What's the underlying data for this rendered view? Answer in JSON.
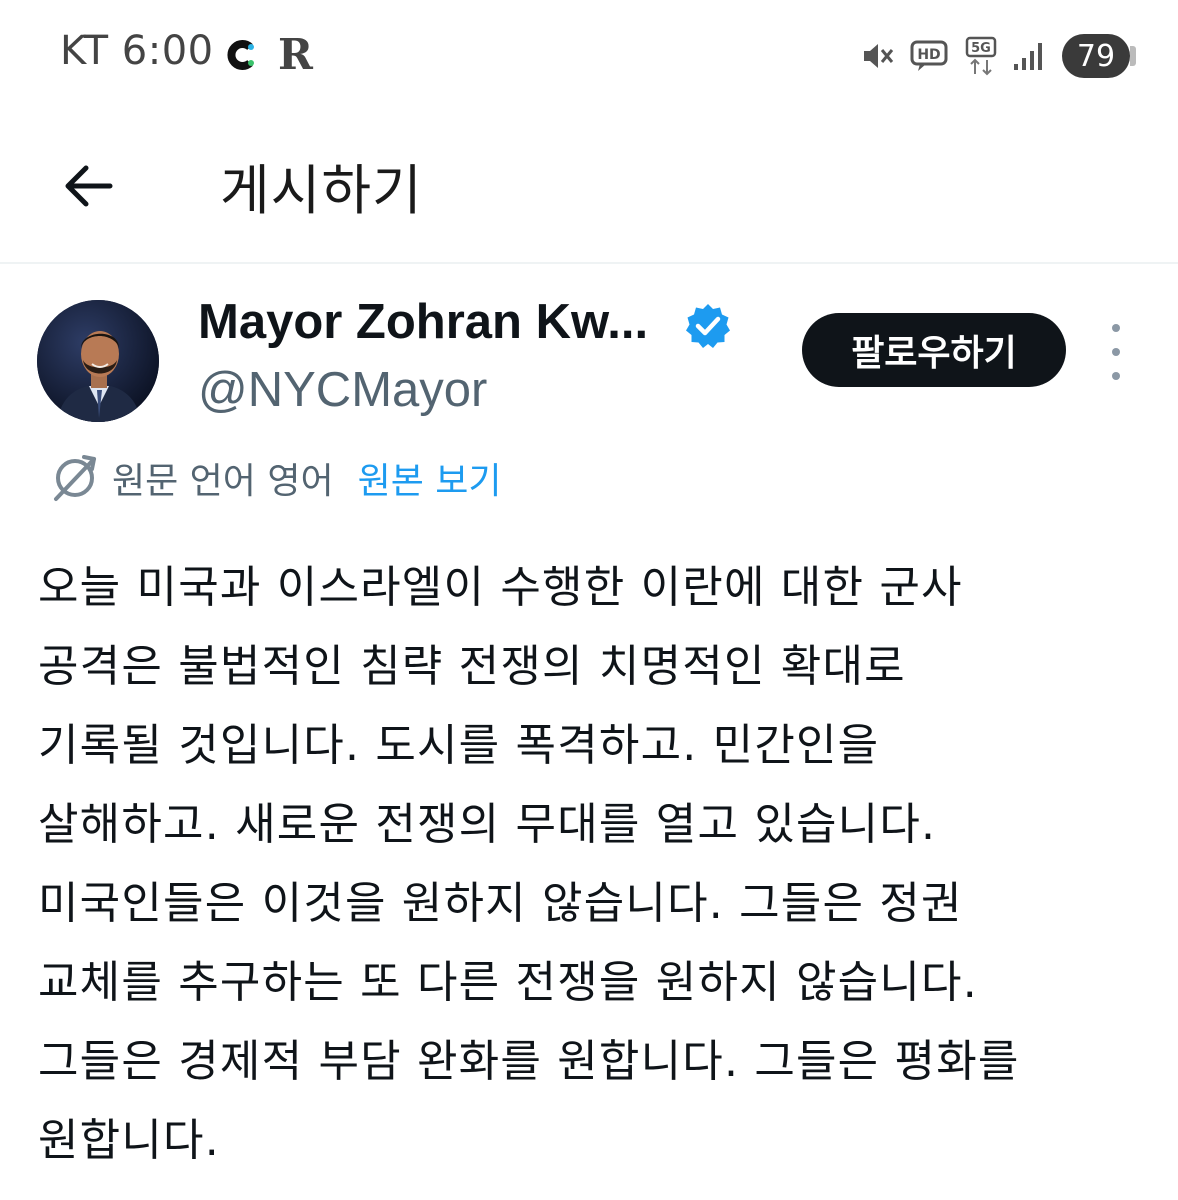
{
  "status_bar": {
    "carrier_time": "KT 6:00",
    "app_icon_r": "R",
    "network_label": "5G",
    "hd_label": "HD",
    "battery_level": "79"
  },
  "header": {
    "title": "게시하기"
  },
  "post": {
    "author_name": "Mayor Zohran Kw...",
    "author_handle": "@NYCMayor",
    "follow_label": "팔로우하기",
    "translation_label": "원문 언어 영어",
    "show_original_label": "원본 보기",
    "lines": [
      "오늘 미국과 이스라엘이 수행한 이란에 대한 군사",
      "공격은 불법적인 침략 전쟁의 치명적인 확대로",
      "기록될 것입니다. 도시를 폭격하고. 민간인을",
      "살해하고. 새로운 전쟁의 무대를 열고 있습니다.",
      "미국인들은 이것을 원하지 않습니다. 그들은 정권",
      "교체를 추구하는 또 다른 전쟁을 원하지 않습니다.",
      "그들은 경제적 부담 완화를 원합니다. 그들은 평화를",
      "원합니다."
    ]
  },
  "colors": {
    "text_primary": "#0f1419",
    "text_secondary": "#536471",
    "link_blue": "#1d9bf0",
    "verified_blue": "#1d9bf0",
    "follow_button_bg": "#0f1419"
  },
  "icons": {
    "back": "arrow-left-icon",
    "verified": "verified-badge-icon",
    "more": "more-vertical-icon",
    "translate": "translate-icon",
    "mute": "mute-icon",
    "signal": "signal-icon"
  }
}
